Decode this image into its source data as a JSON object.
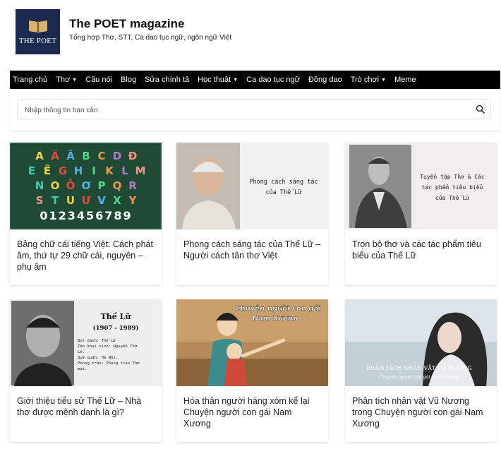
{
  "site": {
    "title": "The POET magazine",
    "tagline": "Tổng hợp Thơ, STT, Ca dao tục ngữ, ngôn ngữ Việt",
    "logo_text": "THE POET"
  },
  "nav": [
    {
      "label": "Trang chủ",
      "dropdown": false
    },
    {
      "label": "Thơ",
      "dropdown": true
    },
    {
      "label": "Câu nói",
      "dropdown": false
    },
    {
      "label": "Blog",
      "dropdown": false
    },
    {
      "label": "Sửa chính tả",
      "dropdown": false
    },
    {
      "label": "Học thuật",
      "dropdown": true
    },
    {
      "label": "Ca dao tục ngữ",
      "dropdown": false
    },
    {
      "label": "Đồng dao",
      "dropdown": false
    },
    {
      "label": "Trò chơi",
      "dropdown": true
    },
    {
      "label": "Meme",
      "dropdown": false
    }
  ],
  "search": {
    "placeholder": "Nhập thông tin bạn cần"
  },
  "thumbs": {
    "alphabet_rows": [
      [
        "A",
        "Ă",
        "Â",
        "B",
        "C",
        "D",
        "Đ"
      ],
      [
        "E",
        "Ê",
        "G",
        "H",
        "I",
        "K",
        "L",
        "M"
      ],
      [
        "N",
        "O",
        "Ô",
        "Ơ",
        "P",
        "Q",
        "R"
      ],
      [
        "S",
        "T",
        "U",
        "Ư",
        "V",
        "X",
        "Y"
      ]
    ],
    "digits": "0123456789",
    "style_caption": [
      "Phong cách sáng tác",
      "của Thế Lữ"
    ],
    "collection_caption": [
      "Tuyển tập Thơ & Các",
      "tác phẩm tiêu biểu",
      "của Thế Lữ"
    ],
    "bio_name": "Thế Lữ",
    "bio_years": "(1907 - 1989)",
    "bio_lines": [
      "Bút danh: Thế Lữ",
      "Tên khai sinh: Nguyễn Thứ",
      "Lễ.",
      "Quê quán: Hà Nội.",
      "Phong trào: Phong trào Thơ",
      "mới."
    ],
    "story_caption": [
      "Chuyện người con gái",
      "Nam Xương"
    ],
    "analysis_caption": [
      "PHÂN TÍCH NHÂN VẬT VŨ NƯƠNG",
      "Chuyện người con gái Nam Xương"
    ]
  },
  "articles": [
    {
      "title": "Bảng chữ cái tiếng Việt: Cách phát âm, thứ tự 29 chữ cái, nguyên – phụ âm"
    },
    {
      "title": "Phong cách sáng tác của Thế Lữ – Người cách tân thơ Việt"
    },
    {
      "title": "Trọn bộ thơ và các tác phẩm tiêu biểu của Thế Lữ"
    },
    {
      "title": "Giới thiệu tiểu sử Thế Lữ – Nhà thơ được mệnh danh là gì?"
    },
    {
      "title": "Hóa thân người hàng xóm kể lại Chuyện người con gái Nam Xương"
    },
    {
      "title": "Phân tích nhân vật Vũ Nương trong Chuyện người con gái Nam Xương"
    }
  ]
}
